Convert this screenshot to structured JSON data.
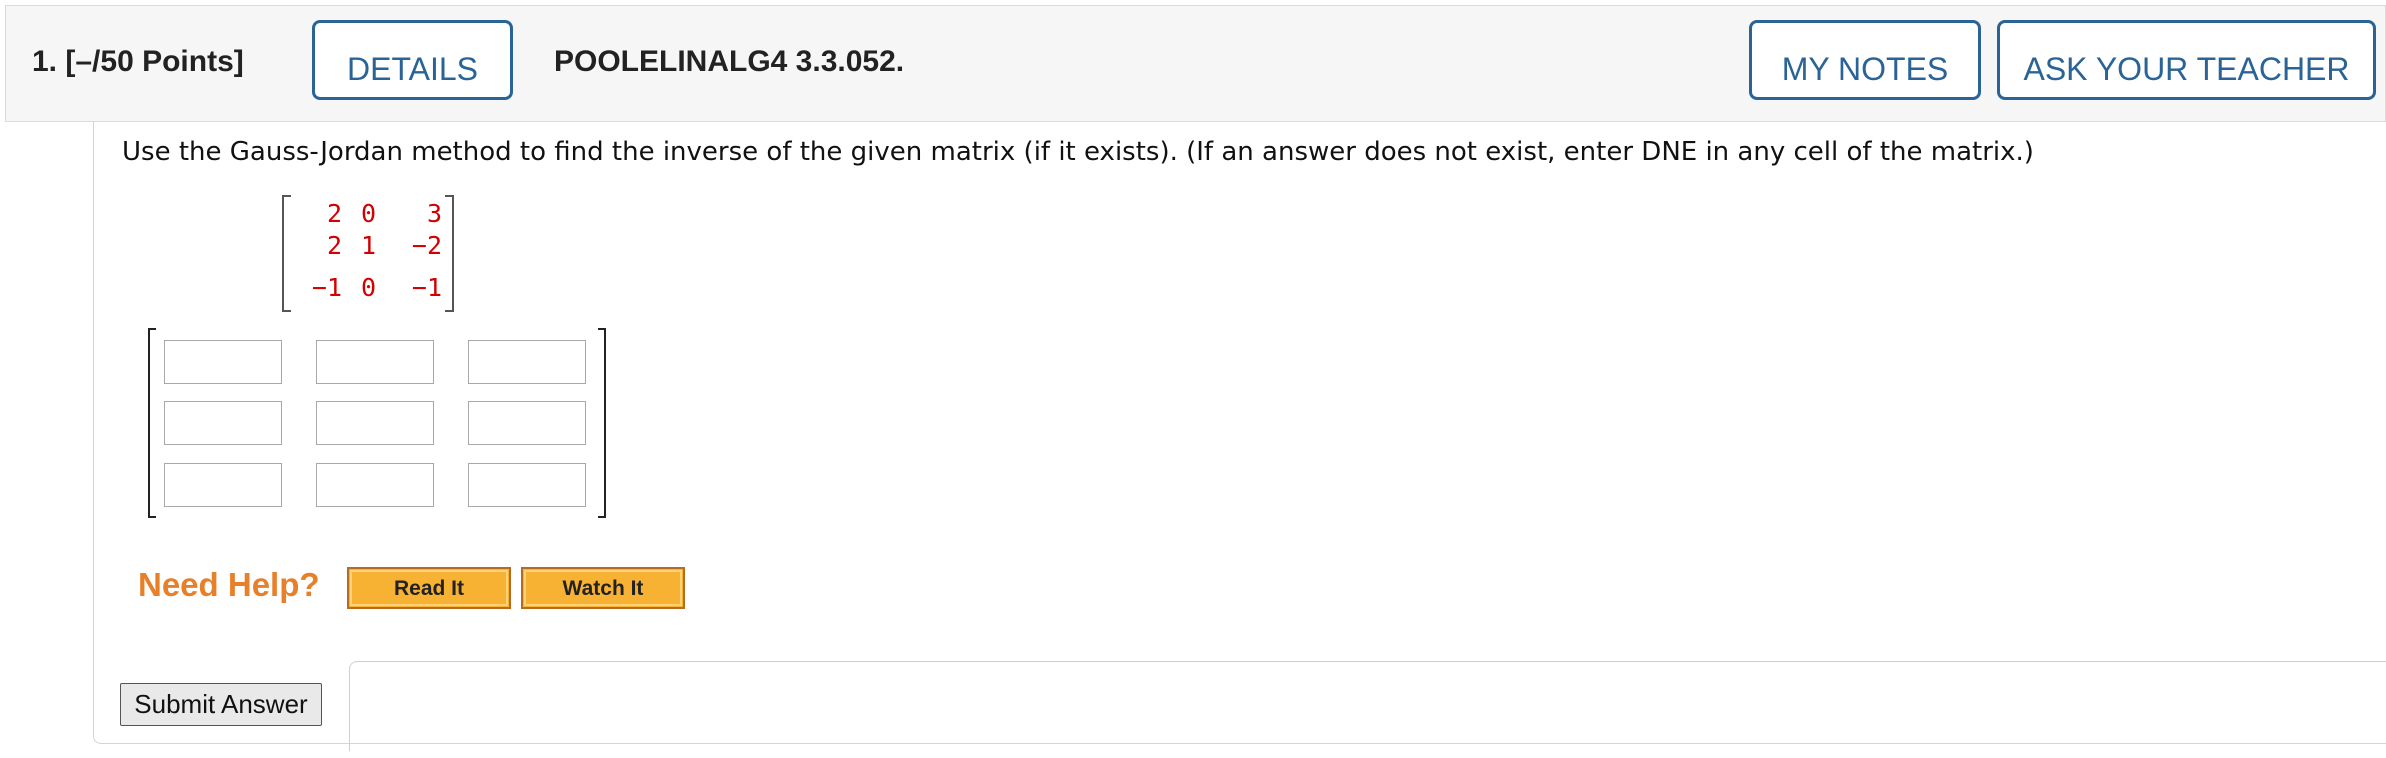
{
  "header": {
    "question_number": "1.",
    "points": "[–/50 Points]",
    "details_label": "DETAILS",
    "question_id": "POOLELINALG4 3.3.052.",
    "my_notes_label": "MY NOTES",
    "ask_teacher_label": "ASK YOUR TEACHER"
  },
  "question": {
    "prompt": "Use the Gauss-Jordan method to find the inverse of the given matrix (if it exists). (If an answer does not exist, enter DNE in any cell of the matrix.)",
    "matrix": [
      [
        "2",
        "0",
        "3"
      ],
      [
        "2",
        "1",
        "−2"
      ],
      [
        "−1",
        "0",
        "−1"
      ]
    ],
    "matrix_color": "#d20000"
  },
  "answer": {
    "cells": [
      [
        "",
        "",
        ""
      ],
      [
        "",
        "",
        ""
      ],
      [
        "",
        "",
        ""
      ]
    ]
  },
  "help": {
    "need_help_label": "Need Help?",
    "read_it_label": "Read It",
    "watch_it_label": "Watch It",
    "accent_color": "#e8802a"
  },
  "submit_label": "Submit Answer",
  "colors": {
    "link_blue": "#2a6496",
    "header_bg": "#f6f6f6"
  }
}
